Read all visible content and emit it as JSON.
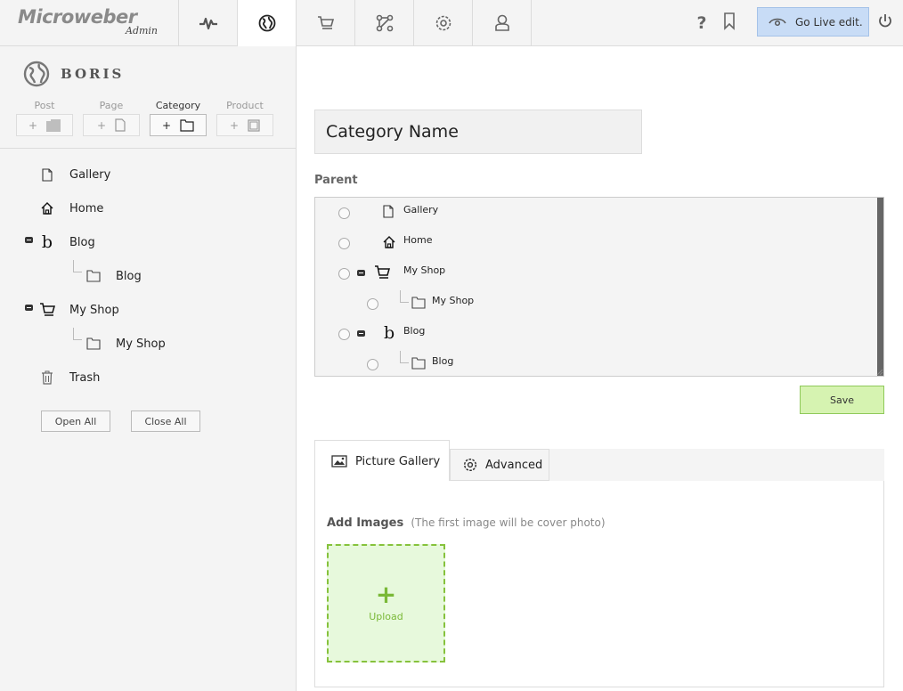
{
  "topbar": {
    "brand": "Microweber",
    "brand_sub": "Admin",
    "help": "?",
    "go_live": "Go Live edit."
  },
  "sidebar": {
    "site_name": "BORIS",
    "add": [
      {
        "label": "Post"
      },
      {
        "label": "Page"
      },
      {
        "label": "Category"
      },
      {
        "label": "Product"
      }
    ],
    "plus": "+",
    "tree": [
      {
        "label": "Gallery",
        "icon": "page-icon"
      },
      {
        "label": "Home",
        "icon": "home-icon"
      },
      {
        "label": "Blog",
        "icon": "blog-icon"
      },
      {
        "label": "Blog",
        "icon": "folder-icon"
      },
      {
        "label": "My Shop",
        "icon": "cart-icon"
      },
      {
        "label": "My Shop",
        "icon": "folder-icon"
      },
      {
        "label": "Trash",
        "icon": "trash-icon"
      }
    ],
    "open_all": "Open All",
    "close_all": "Close All"
  },
  "main": {
    "category_name": "Category Name",
    "parent_label": "Parent",
    "parent_tree": [
      {
        "label": "Gallery",
        "icon": "page-icon"
      },
      {
        "label": "Home",
        "icon": "home-icon"
      },
      {
        "label": "My Shop",
        "icon": "cart-icon"
      },
      {
        "label": "My Shop",
        "icon": "folder-icon"
      },
      {
        "label": "Blog",
        "icon": "blog-icon"
      },
      {
        "label": "Blog",
        "icon": "folder-icon"
      }
    ],
    "save": "Save",
    "tabs": [
      {
        "label": "Picture Gallery"
      },
      {
        "label": "Advanced"
      }
    ],
    "add_images": "Add Images",
    "add_images_hint": "(The first image will be cover photo)",
    "upload_plus": "+",
    "upload": "Upload"
  },
  "colors": {
    "go_live_bg": "#c8dcf6",
    "save_bg": "#d6f3b1",
    "upload_accent": "#7ab937"
  }
}
